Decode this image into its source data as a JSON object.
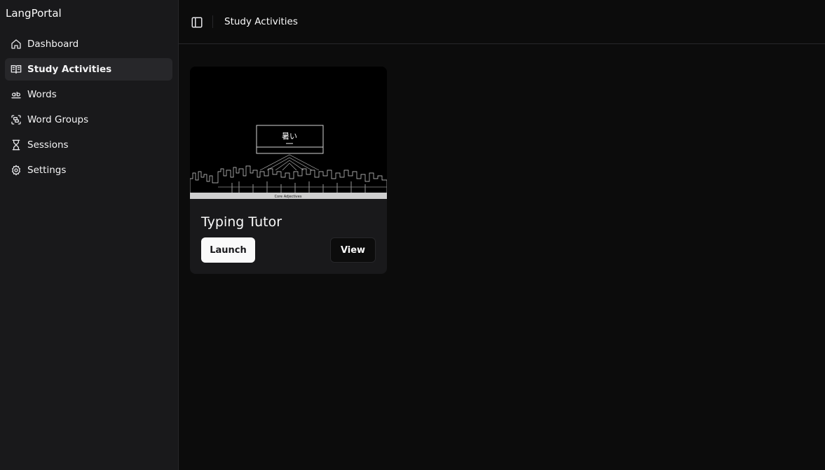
{
  "app": {
    "name": "LangPortal"
  },
  "sidebar": {
    "items": [
      {
        "label": "Dashboard",
        "icon": "home-icon",
        "active": false
      },
      {
        "label": "Study Activities",
        "icon": "book-open-icon",
        "active": true
      },
      {
        "label": "Words",
        "icon": "whole-word-icon",
        "active": false
      },
      {
        "label": "Word Groups",
        "icon": "group-icon",
        "active": false
      },
      {
        "label": "Sessions",
        "icon": "hourglass-icon",
        "active": false
      },
      {
        "label": "Settings",
        "icon": "gear-icon",
        "active": false
      }
    ]
  },
  "header": {
    "title": "Study Activities",
    "toggle_icon": "panel-left-icon"
  },
  "activities": [
    {
      "title": "Typing Tutor",
      "launch_label": "Launch",
      "view_label": "View",
      "thumbnail": {
        "word": "暑い",
        "footer_center": "Core Adjectives"
      }
    }
  ]
}
